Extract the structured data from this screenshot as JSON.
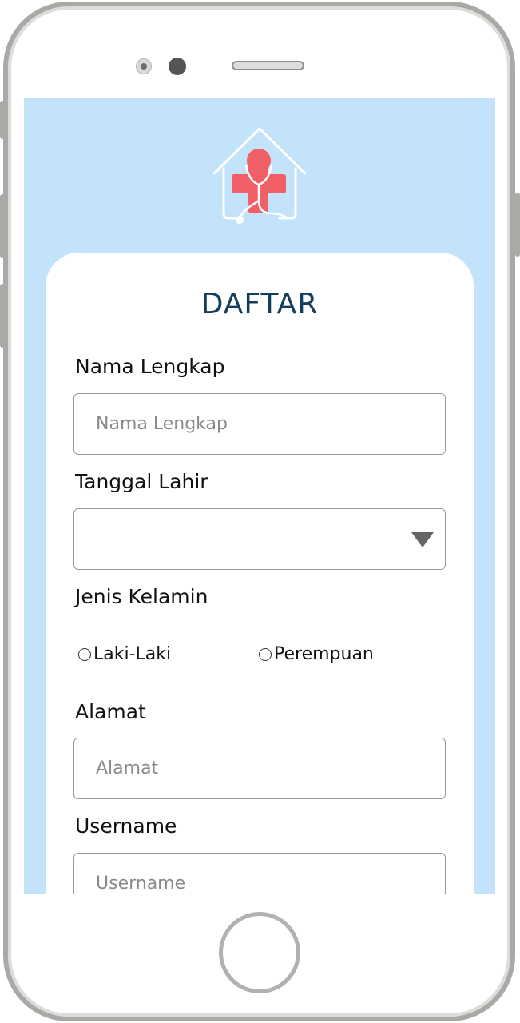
{
  "app": {
    "logo_icon": "house-stethoscope-cross-logo",
    "colors": {
      "screen_background": "#c3e3fb",
      "title": "#143e5c",
      "logo_cross": "#f26067"
    }
  },
  "form": {
    "title": "DAFTAR",
    "full_name": {
      "label": "Nama Lengkap",
      "placeholder": "Nama Lengkap",
      "value": ""
    },
    "birth_date": {
      "label": "Tanggal Lahir",
      "value": ""
    },
    "gender": {
      "label": "Jenis Kelamin",
      "options": [
        "Laki-Laki",
        "Perempuan"
      ],
      "selected": null
    },
    "address": {
      "label": "Alamat",
      "placeholder": "Alamat",
      "value": ""
    },
    "username": {
      "label": "Username",
      "placeholder": "Username",
      "value": ""
    }
  }
}
